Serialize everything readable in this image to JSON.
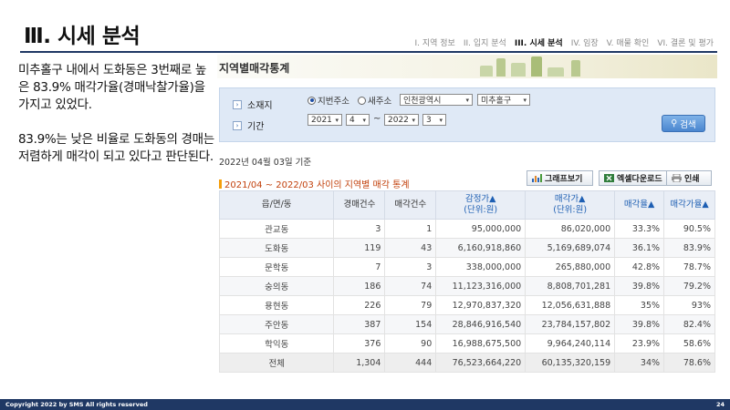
{
  "slide": {
    "title": "Ⅲ. 시세 분석",
    "nav": [
      {
        "label": "I. 지역 정보",
        "active": false
      },
      {
        "label": "II. 입지 분석",
        "active": false
      },
      {
        "label": "III. 시세 분석",
        "active": true
      },
      {
        "label": "IV. 임장",
        "active": false
      },
      {
        "label": "V. 매물 확인",
        "active": false
      },
      {
        "label": "VI. 결론 및 평가",
        "active": false
      }
    ],
    "notes": [
      "미추홀구 내에서 도화동은 3번째로 높은 83.9% 매각가율(경매낙찰가율)을 가지고 있었다.",
      "83.9%는 낮은 비율로 도화동의 경매는 저렴하게 매각이 되고 있다고 판단된다."
    ],
    "footer_left": "Copyright 2022 by SMS All rights reserved",
    "page_number": "24"
  },
  "panel": {
    "banner_title": "지역별매각통계",
    "search": {
      "location_label": "소재지",
      "period_label": "기간",
      "radio_jibun": "지번주소",
      "radio_new": "새주소",
      "radio_selected": "지번주소",
      "city": "인천광역시",
      "district": "미추홀구",
      "start_year": "2021",
      "start_month": "4",
      "tilde": "~",
      "end_year": "2022",
      "end_month": "3",
      "search_button": "검색"
    },
    "base_date": "2022년 04월 03일 기준",
    "table_title": "2021/04 ~ 2022/03 사이의 지역별 매각 통계",
    "buttons": {
      "graph": "그래프보기",
      "excel": "엑셀다운로드",
      "print": "인쇄"
    },
    "table": {
      "headers": {
        "region": "읍/면/동",
        "auction_count": "경매건수",
        "sold_count": "매각건수",
        "appraisal": "감정가▲",
        "appraisal_unit": "(단위:원)",
        "sale_price": "매각가▲",
        "sale_price_unit": "(단위:원)",
        "sale_rate": "매각율▲",
        "sale_price_rate": "매각가율▲"
      },
      "rows": [
        {
          "region": "관교동",
          "auction_count": "3",
          "sold_count": "1",
          "appraisal": "95,000,000",
          "sale_price": "86,020,000",
          "sale_rate": "33.3%",
          "sale_price_rate": "90.5%"
        },
        {
          "region": "도화동",
          "auction_count": "119",
          "sold_count": "43",
          "appraisal": "6,160,918,860",
          "sale_price": "5,169,689,074",
          "sale_rate": "36.1%",
          "sale_price_rate": "83.9%"
        },
        {
          "region": "문학동",
          "auction_count": "7",
          "sold_count": "3",
          "appraisal": "338,000,000",
          "sale_price": "265,880,000",
          "sale_rate": "42.8%",
          "sale_price_rate": "78.7%"
        },
        {
          "region": "숭의동",
          "auction_count": "186",
          "sold_count": "74",
          "appraisal": "11,123,316,000",
          "sale_price": "8,808,701,281",
          "sale_rate": "39.8%",
          "sale_price_rate": "79.2%"
        },
        {
          "region": "용현동",
          "auction_count": "226",
          "sold_count": "79",
          "appraisal": "12,970,837,320",
          "sale_price": "12,056,631,888",
          "sale_rate": "35%",
          "sale_price_rate": "93%"
        },
        {
          "region": "주안동",
          "auction_count": "387",
          "sold_count": "154",
          "appraisal": "28,846,916,540",
          "sale_price": "23,784,157,802",
          "sale_rate": "39.8%",
          "sale_price_rate": "82.4%"
        },
        {
          "region": "학익동",
          "auction_count": "376",
          "sold_count": "90",
          "appraisal": "16,988,675,500",
          "sale_price": "9,964,240,114",
          "sale_rate": "23.9%",
          "sale_price_rate": "58.6%"
        },
        {
          "region": "전체",
          "auction_count": "1,304",
          "sold_count": "444",
          "appraisal": "76,523,664,220",
          "sale_price": "60,135,320,159",
          "sale_rate": "34%",
          "sale_price_rate": "78.6%"
        }
      ]
    }
  }
}
